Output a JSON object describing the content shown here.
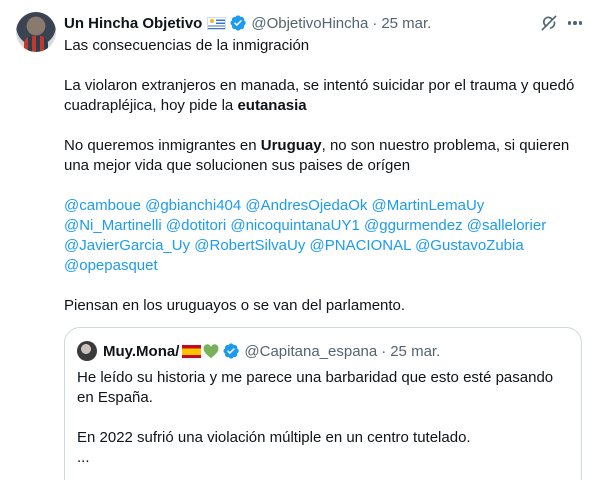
{
  "tweet": {
    "author_name": "Un Hincha Objetivo",
    "handle": "@ObjetivoHincha",
    "separator": "·",
    "time": "25 mar.",
    "avatar_icon": "user-avatar",
    "flag": "uruguay-flag",
    "verified_color": "#1d9bf0",
    "text": {
      "line1": "Las consecuencias de la inmigración",
      "p2_a": "La violaron extranjeros en manada, se intentó suicidar por el trauma y quedó cuadrapléjica, hoy pide la ",
      "p2_bold": "eutanasia",
      "p3_a": "No queremos inmigrantes en ",
      "p3_bold": "Uruguay",
      "p3_b": ", no son nuestro problema, si quieren una mejor vida que solucionen sus paises de orígen",
      "closing": "Piensan en los uruguayos o se van del parlamento."
    },
    "mentions": [
      "@camboue",
      "@gbianchi404",
      "@AndresOjedaOk",
      "@MartinLemaUy",
      "@Ni_Martinelli",
      "@dotitori",
      "@nicoquintanaUY1",
      "@ggurmendez",
      "@sallelorier",
      "@JavierGarcia_Uy",
      "@RobertSilvaUy",
      "@PNACIONAL",
      "@GustavoZubia",
      "@opepasquet"
    ],
    "mention_color": "#1d9bf0"
  },
  "quote": {
    "author_name": "Muy.Mona/",
    "flag": "spain-flag",
    "emoji": "green-heart",
    "handle": "@Capitana_espana",
    "separator": "·",
    "time": "25 mar.",
    "text_line1": "He leído su historia y me parece una barbaridad que esto esté pasando en España.",
    "text_line2": "En 2022 sufrió una violación múltiple en un centro tutelado.",
    "ellipsis": "..."
  }
}
